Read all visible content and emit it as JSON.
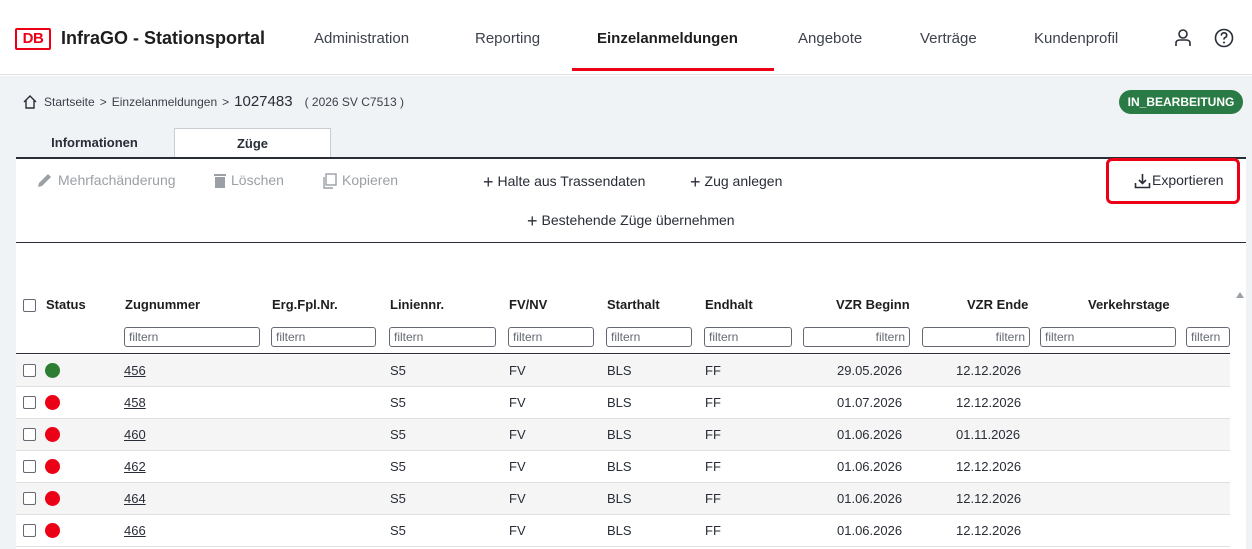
{
  "header": {
    "logo_text": "DB",
    "title": "InfraGO - Stationsportal",
    "nav": [
      "Administration",
      "Reporting",
      "Einzelanmeldungen",
      "Angebote",
      "Verträge",
      "Kundenprofil"
    ],
    "active_nav": "Einzelanmeldungen",
    "icons": [
      "user-icon",
      "help-icon"
    ]
  },
  "breadcrumb": {
    "home": "Startseite",
    "section": "Einzelanmeldungen",
    "id": "1027483",
    "sub": "( 2026 SV C7513 )"
  },
  "status_badge": "IN_BEARBEITUNG",
  "tabs": {
    "informationen": "Informationen",
    "zuege": "Züge"
  },
  "toolbar": {
    "mehrfach": "Mehrfachänderung",
    "loeschen": "Löschen",
    "kopieren": "Kopieren",
    "halte": "Halte aus Trassendaten",
    "zug_anlegen": "Zug anlegen",
    "bestehende": "Bestehende Züge übernehmen",
    "exportieren": "Exportieren"
  },
  "table": {
    "headers": {
      "status": "Status",
      "zugnummer": "Zugnummer",
      "ergfpl": "Erg.Fpl.Nr.",
      "linie": "Liniennr.",
      "fvnv": "FV/NV",
      "start": "Starthalt",
      "end": "Endhalt",
      "vzrb": "VZR Beginn",
      "vzre": "VZR Ende",
      "vtage": "Verkehrstage"
    },
    "filter_placeholder": "filtern",
    "rows": [
      {
        "status": "green",
        "zugnummer": "456",
        "ergfpl": "",
        "linie": "S5",
        "fvnv": "FV",
        "start": "BLS",
        "end": "FF",
        "vzrb": "29.05.2026",
        "vzre": "12.12.2026"
      },
      {
        "status": "red",
        "zugnummer": "458",
        "ergfpl": "",
        "linie": "S5",
        "fvnv": "FV",
        "start": "BLS",
        "end": "FF",
        "vzrb": "01.07.2026",
        "vzre": "12.12.2026"
      },
      {
        "status": "red",
        "zugnummer": "460",
        "ergfpl": "",
        "linie": "S5",
        "fvnv": "FV",
        "start": "BLS",
        "end": "FF",
        "vzrb": "01.06.2026",
        "vzre": "01.11.2026"
      },
      {
        "status": "red",
        "zugnummer": "462",
        "ergfpl": "",
        "linie": "S5",
        "fvnv": "FV",
        "start": "BLS",
        "end": "FF",
        "vzrb": "01.06.2026",
        "vzre": "12.12.2026"
      },
      {
        "status": "red",
        "zugnummer": "464",
        "ergfpl": "",
        "linie": "S5",
        "fvnv": "FV",
        "start": "BLS",
        "end": "FF",
        "vzrb": "01.06.2026",
        "vzre": "12.12.2026"
      },
      {
        "status": "red",
        "zugnummer": "466",
        "ergfpl": "",
        "linie": "S5",
        "fvnv": "FV",
        "start": "BLS",
        "end": "FF",
        "vzrb": "01.06.2026",
        "vzre": "12.12.2026"
      }
    ]
  },
  "colors": {
    "brand_red": "#ec0016",
    "status_green": "#2a7a45",
    "status_red": "#ec0016",
    "dot_green": "#2e7d32"
  }
}
